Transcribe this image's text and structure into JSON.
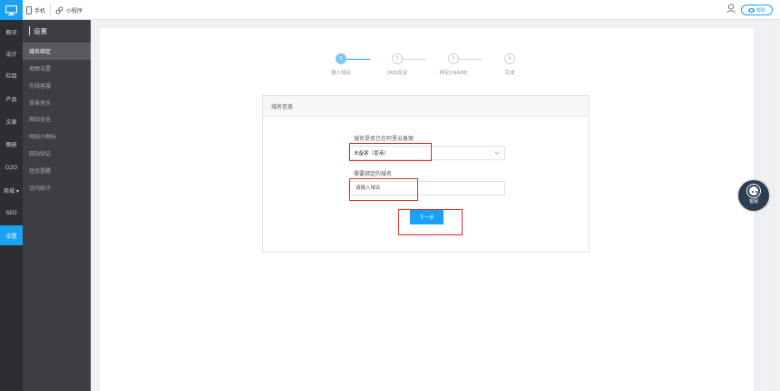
{
  "topbar": {
    "phone_label": "手机",
    "miniapp_label": "小程序",
    "help_label": "帮助"
  },
  "rail": {
    "items": [
      {
        "label": "概况"
      },
      {
        "label": "设计"
      },
      {
        "label": "栏目"
      },
      {
        "label": "产品"
      },
      {
        "label": "文章"
      },
      {
        "label": "图册"
      },
      {
        "label": "O2O"
      },
      {
        "label": "商城 ▾"
      },
      {
        "label": "SEO"
      },
      {
        "label": "设置",
        "active": true
      }
    ]
  },
  "subnav": {
    "title": "设置",
    "items": [
      {
        "label": "域名绑定",
        "active": true
      },
      {
        "label": "地图设置"
      },
      {
        "label": "在线客服"
      },
      {
        "label": "背景音乐"
      },
      {
        "label": "网站安全"
      },
      {
        "label": "网站小图标"
      },
      {
        "label": "网站验证"
      },
      {
        "label": "短信提醒"
      },
      {
        "label": "访问统计"
      }
    ]
  },
  "steps": [
    {
      "num": "1",
      "label": "输入域名",
      "done": true
    },
    {
      "num": "2",
      "label": "DNS验证"
    },
    {
      "num": "3",
      "label": "绑定CNAME"
    },
    {
      "num": "4",
      "label": "完成"
    }
  ],
  "card": {
    "title": "域名信息",
    "filed_label": "域名是否已在阿里云备案",
    "filed_value": "未备案（香港）",
    "domain_label": "需要绑定的域名",
    "domain_placeholder": "请输入域名",
    "next_label": "下一步"
  },
  "service": {
    "label": "客服"
  },
  "colors": {
    "accent": "#1aa1f3",
    "rail_bg": "#2d2e33",
    "subnav_bg": "#3d3e44",
    "annotation": "#e02a2a"
  }
}
